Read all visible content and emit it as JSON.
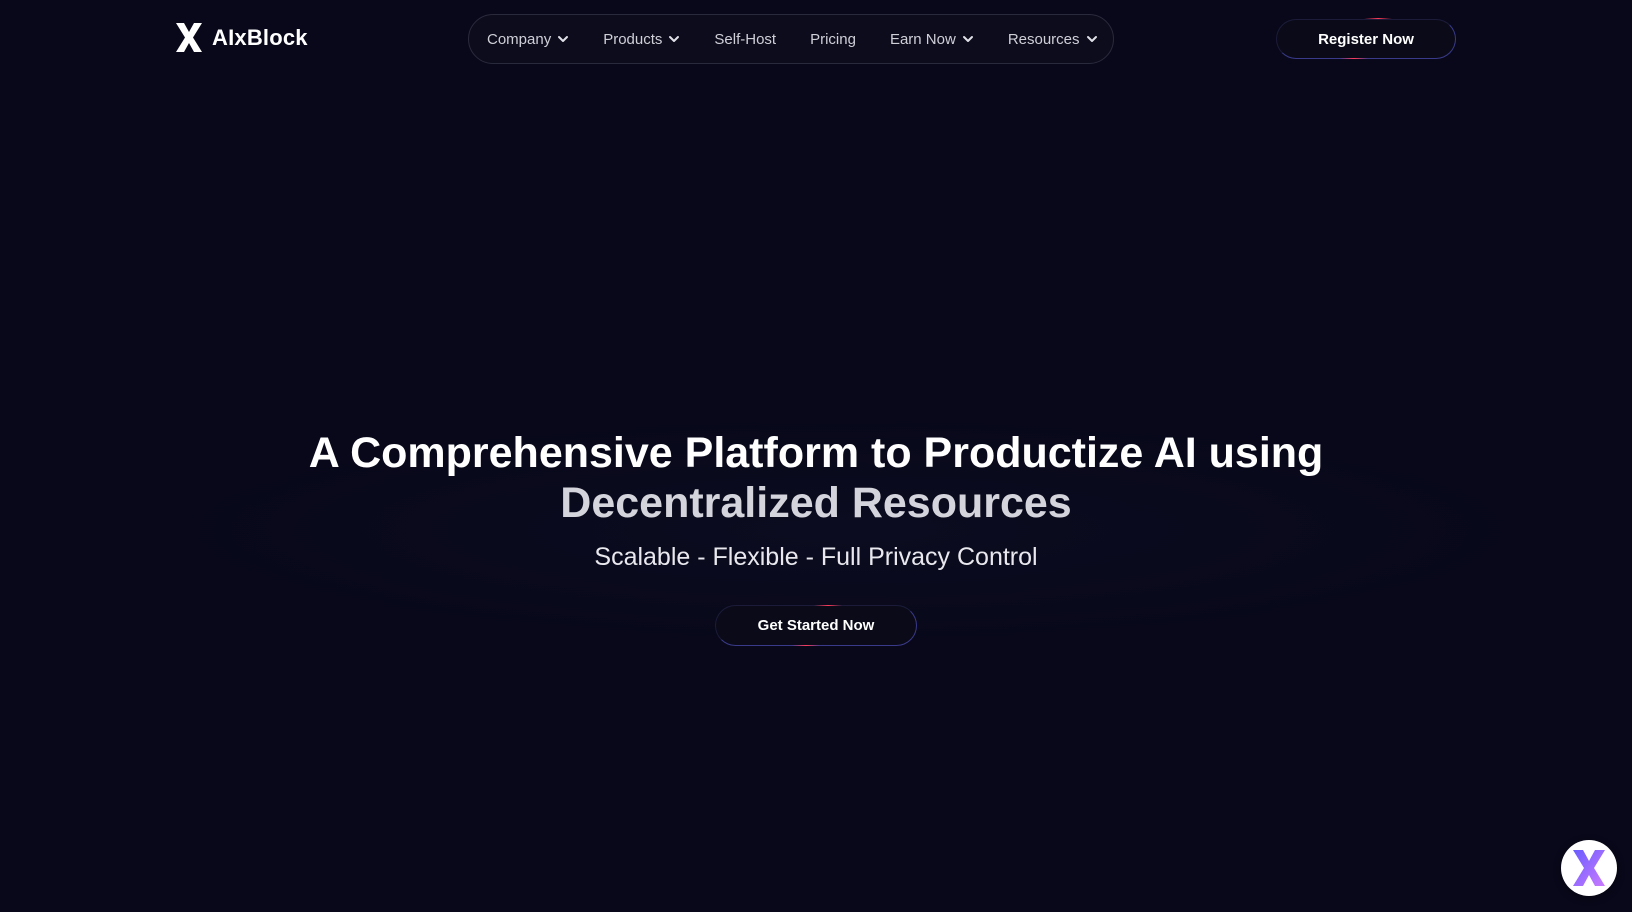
{
  "header": {
    "logo_text": "AIxBlock",
    "nav": [
      {
        "label": "Company",
        "has_dropdown": true
      },
      {
        "label": "Products",
        "has_dropdown": true
      },
      {
        "label": "Self-Host",
        "has_dropdown": false
      },
      {
        "label": "Pricing",
        "has_dropdown": false
      },
      {
        "label": "Earn Now",
        "has_dropdown": true
      },
      {
        "label": "Resources",
        "has_dropdown": true
      }
    ],
    "register_label": "Register Now"
  },
  "hero": {
    "title_line1": "A Comprehensive Platform to Productize AI using",
    "title_line2": "Decentralized Resources",
    "subtitle": "Scalable - Flexible - Full Privacy Control",
    "cta_label": "Get Started Now"
  },
  "icons": {
    "logo": "aixblock-x-logo-icon",
    "dropdown": "chevron-down-icon",
    "chat": "aixblock-chat-launcher-icon"
  },
  "colors": {
    "background": "#08081a",
    "text": "#ffffff",
    "nav_text": "#cfcfd8",
    "button_border_accent": "#3a3a8a",
    "accent_red": "#ff3c5a",
    "chat_gradient_start": "#6a5cff",
    "chat_gradient_end": "#c97bff"
  }
}
